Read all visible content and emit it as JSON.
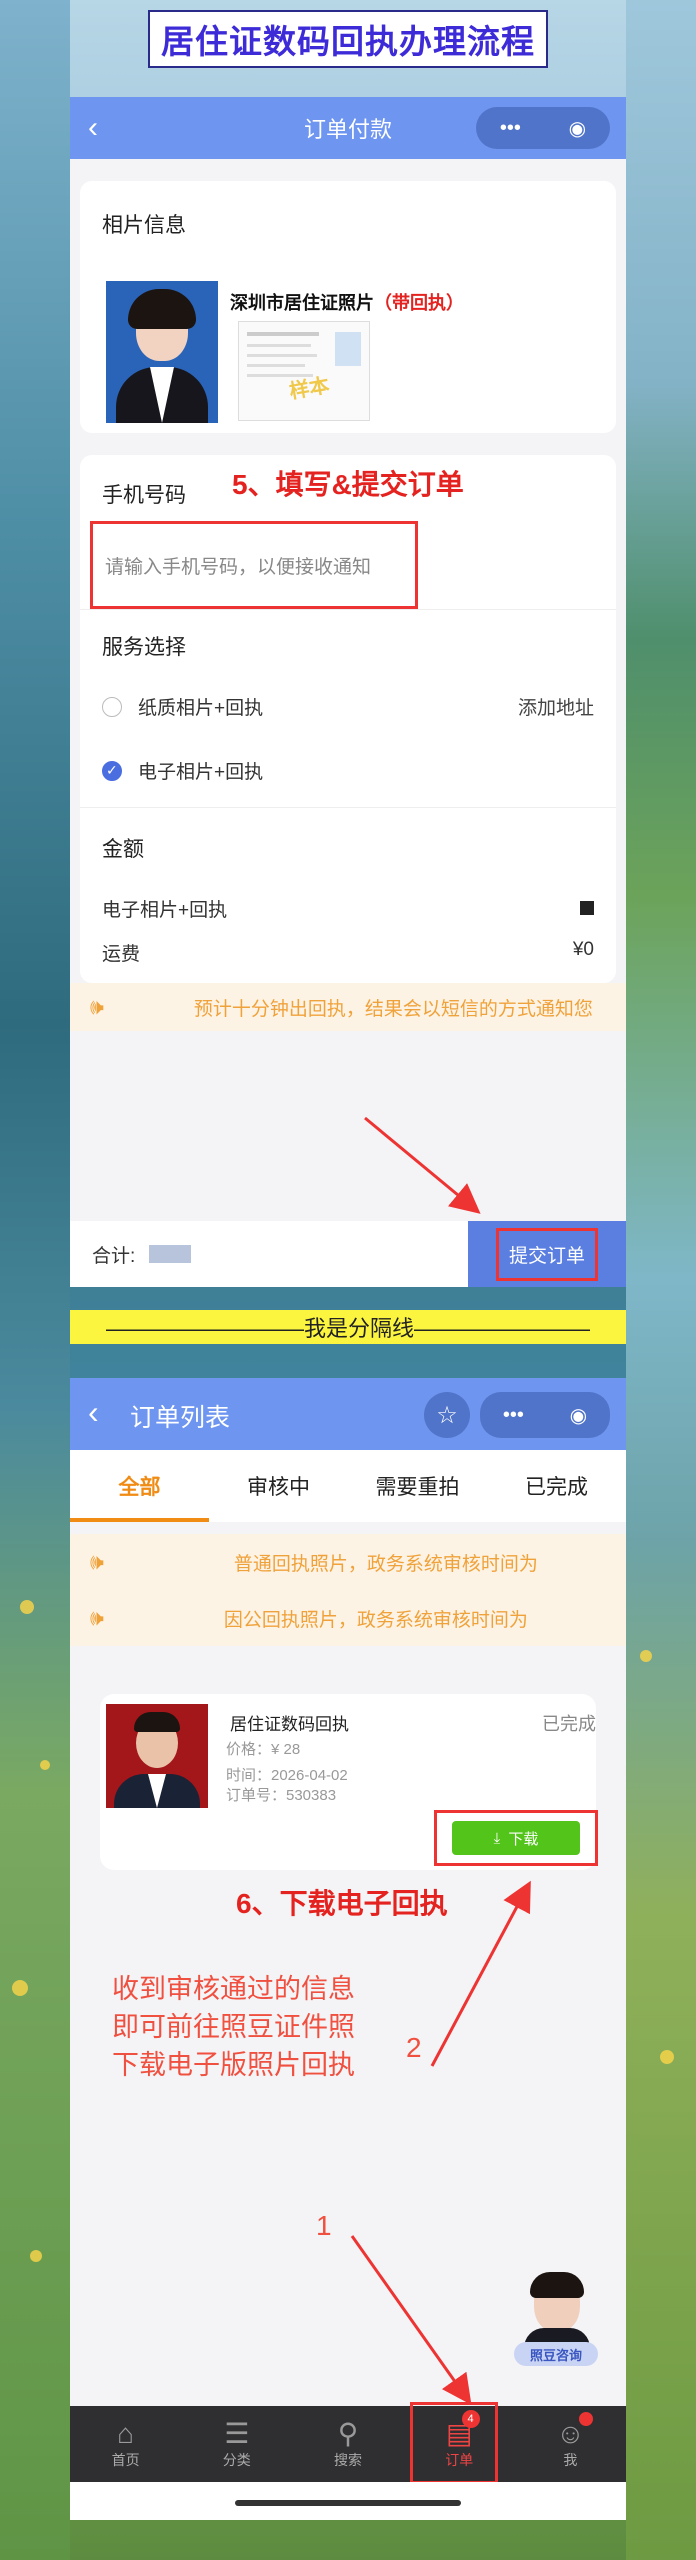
{
  "banner_title": "居住证数码回执办理流程",
  "screen1": {
    "nav_title": "订单付款",
    "back_icon": "‹",
    "capsule_more": "•••",
    "capsule_close": "◉",
    "photo_section_label": "相片信息",
    "product_name": "深圳市居住证照片",
    "product_tag": "（带回执）",
    "sample_stamp": "样本",
    "phone_label": "手机号码",
    "phone_placeholder": "请输入手机号码，以便接收通知",
    "step5_note": "5、填写&提交订单",
    "service_label": "服务选择",
    "option1": "纸质相片+回执",
    "option1_action": "添加地址",
    "option2": "电子相片+回执",
    "amount_label": "金额",
    "amount_item1": "电子相片+回执",
    "amount_item2": "运费",
    "shipping_fee": "¥0",
    "notice_text": "预计十分钟出回执，结果会以短信的方式通知您",
    "total_label": "合计:",
    "submit_button": "提交订单"
  },
  "divider_text": "—————————我是分隔线————————",
  "screen2": {
    "nav_title": "订单列表",
    "tabs": [
      "全部",
      "审核中",
      "需要重拍",
      "已完成"
    ],
    "notice1": "普通回执照片，政务系统审核时间为",
    "notice2": "因公回执照片，政务系统审核时间为",
    "order_title": "居住证数码回执",
    "order_status": "已完成",
    "order_price": "价格：¥ 28",
    "order_time": "时间：2026-04-02",
    "order_number": "订单号：530383",
    "download_button": "下载",
    "step6_note": "6、下载电子回执",
    "hint_line1": "收到审核通过的信息",
    "hint_line2": "即可前往照豆证件照",
    "hint_line3": "下载电子版照片回执",
    "arrow_label_1": "1",
    "arrow_label_2": "2",
    "consult_label": "照豆咨询",
    "order_badge": "4",
    "bottom_nav": [
      "首页",
      "分类",
      "搜索",
      "订单",
      "我"
    ]
  },
  "colors": {
    "nav_blue": "#6e95f0",
    "accent_orange": "#f08b14",
    "annotation_red": "#e4221f",
    "download_green": "#52c41a",
    "submit_blue": "#5b7fe0"
  }
}
